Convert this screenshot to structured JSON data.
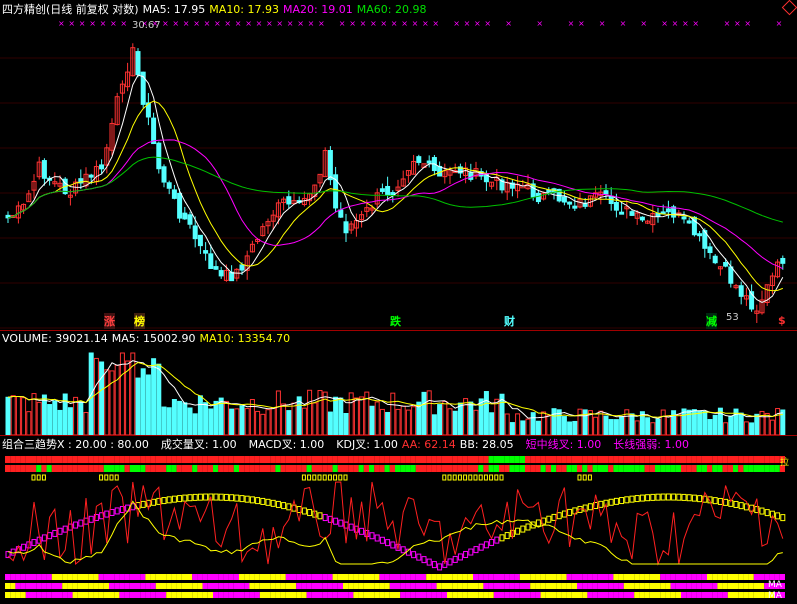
{
  "main_panel": {
    "title": "四方精创(日线 前复权 对数)",
    "ma5": "MA5: 17.95",
    "ma10": "MA10: 17.93",
    "ma20": "MA20: 19.01",
    "ma60": "MA60: 20.98",
    "high_label": "30.67",
    "low_label": "53",
    "signals": [
      "涨",
      "榜",
      "跌",
      "财",
      "减"
    ],
    "dollar_mark": "$",
    "colors": {
      "up": "#ff3232",
      "down": "#54ffff",
      "ma5": "#ffffff",
      "ma10": "#ffff00",
      "ma20": "#ff00ff",
      "ma60": "#00c000"
    }
  },
  "volume_panel": {
    "volume": "VOLUME: 39021.14",
    "ma5": "MA5: 15002.90",
    "ma10": "MA10: 13354.70"
  },
  "indicator_panel": {
    "title": "组合三趋势X : 20.00 : 80.00",
    "labels": [
      "成交量叉: 1.00",
      "MACD叉: 1.00",
      "KDJ叉: 1.00",
      "AA: 62.14",
      "BB: 28.05",
      "短中线叉: 1.00",
      "长线强弱: 1.00"
    ],
    "right_tags": [
      "拉",
      "MA",
      "MA"
    ]
  },
  "chart_data": {
    "type": "candlestick",
    "series": [
      {
        "name": "MA5",
        "value": 17.95
      },
      {
        "name": "MA10",
        "value": 17.93
      },
      {
        "name": "MA20",
        "value": 19.01
      },
      {
        "name": "MA60",
        "value": 20.98
      }
    ],
    "max_price": 30.67,
    "volume_latest": 39021.14
  }
}
